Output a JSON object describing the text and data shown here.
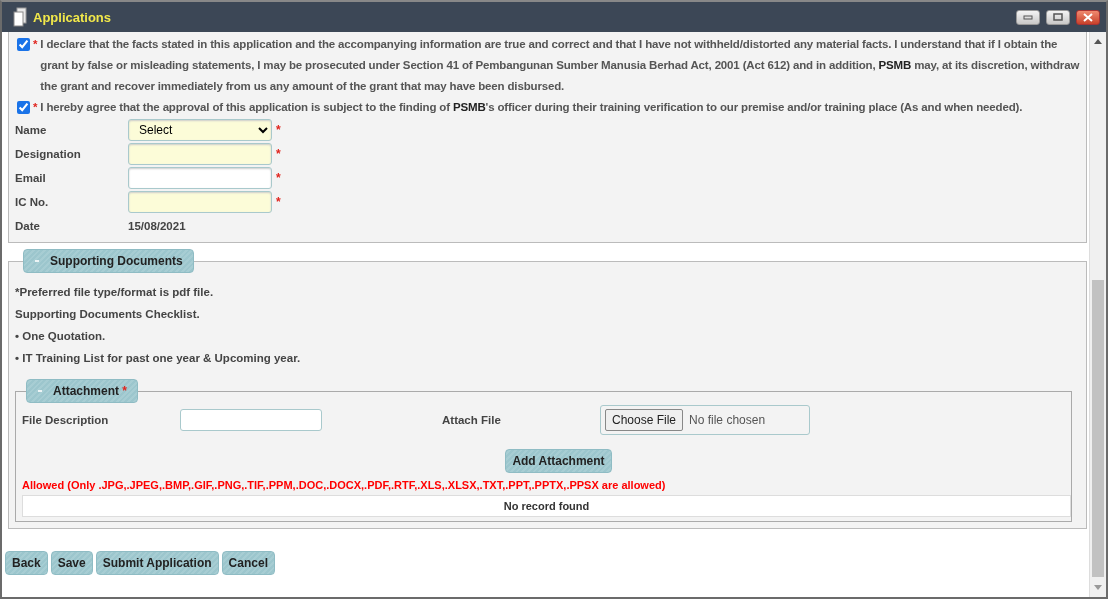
{
  "window": {
    "title": "Applications"
  },
  "declarations": [
    {
      "checked": true,
      "required_mark": "*",
      "text": "I declare that the facts stated in this application and the accompanying information are true and correct and that I have not withheld/distorted any material facts. I understand that if I obtain the grant by false or misleading statements, I may be prosecuted under Section 41 of Pembangunan Sumber Manusia Berhad Act, 2001 (Act 612) and in addition, **PSMB** may, at its discretion, withdraw the grant and recover immediately from us any amount of the grant that may have been disbursed."
    },
    {
      "checked": true,
      "required_mark": "*",
      "text": "I hereby agree that the approval of this application is subject to the finding of **PSMB**'s officer during their training verification to our premise and/or training place (As and when needed)."
    }
  ],
  "form": {
    "fields": [
      {
        "kind": "select",
        "label": "Name",
        "value": "Select",
        "required_mark": "*",
        "highlighted": true
      },
      {
        "kind": "text",
        "label": "Designation",
        "required_mark": "*",
        "highlighted": true
      },
      {
        "kind": "text",
        "label": "Email",
        "required_mark": "*",
        "highlighted": false
      },
      {
        "kind": "text",
        "label": "IC No.",
        "required_mark": "*",
        "highlighted": true
      },
      {
        "kind": "static",
        "label": "Date",
        "value": "15/08/2021"
      }
    ]
  },
  "supporting_documents": {
    "title": "Supporting Documents",
    "expanded": true,
    "notes": [
      "*Preferred file type/format is pdf file.",
      "Supporting Documents Checklist.",
      "• One Quotation.",
      "• IT Training List for past one year & Upcoming year."
    ],
    "attachment": {
      "title": "Attachment",
      "required_mark": "*",
      "expanded": true,
      "description_label": "File Description",
      "file_label": "Attach File",
      "choose_button": "Choose File",
      "file_status": "No file chosen",
      "add_button": "Add Attachment",
      "allowed_note": "Allowed (Only .JPG,.JPEG,.BMP,.GIF,.PNG,.TIF,.PPM,.DOC,.DOCX,.PDF,.RTF,.XLS,.XLSX,.TXT,.PPT,.PPTX,.PPSX are allowed)",
      "empty_message": "No record found"
    }
  },
  "buttons": [
    "Back",
    "Save",
    "Submit Application",
    "Cancel"
  ]
}
